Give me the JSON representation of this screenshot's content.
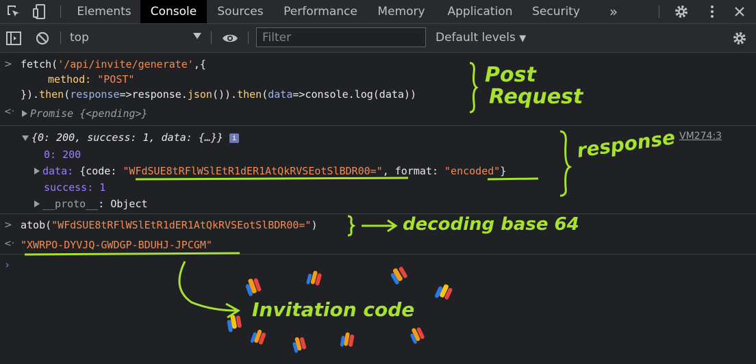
{
  "tabs": {
    "elements": "Elements",
    "console": "Console",
    "sources": "Sources",
    "performance": "Performance",
    "memory": "Memory",
    "application": "Application",
    "security": "Security",
    "more": "»"
  },
  "toolbar": {
    "context": "top",
    "filter_placeholder": "Filter",
    "levels": "Default levels"
  },
  "console": {
    "req_line1_a": "fetch(",
    "req_url": "'/api/invite/generate'",
    "req_line1_b": ",{",
    "req_method_key": "method: ",
    "req_method_val": "\"POST\"",
    "req_line3_a": "}).",
    "req_then1": "then",
    "req_line3_b": "(",
    "req_resp": "response",
    "req_line3_c": "=>response.",
    "req_json": "json",
    "req_line3_d": "()).",
    "req_then2": "then",
    "req_line3_e": "(",
    "req_data": "data",
    "req_line3_f": "=>console.log(data))",
    "promise": "Promise {<pending>}",
    "resp_summary": "{0: 200, success: 1, data: {…}}",
    "resp_link": "VM274:3",
    "resp_info": "i",
    "resp_zero_key": "0: ",
    "resp_zero_val": "200",
    "resp_data_key": "data: ",
    "resp_data_open": "{code: ",
    "resp_code": "\"WFdSUE8tRFlWSlEtR1dER1AtQkRVSEotSlBDR00=\"",
    "resp_format_key": ", format: ",
    "resp_format": "\"encoded\"",
    "resp_data_close": "}",
    "resp_success_key": "success: ",
    "resp_success_val": "1",
    "resp_proto_key": "__proto__",
    "resp_proto_val": ": Object",
    "atob_a": "atob(",
    "atob_arg": "\"WFdSUE8tRFlWSlEtR1dER1AtQkRVSEotSlBDR00=\"",
    "atob_b": ")",
    "result": "\"XWRPO-DYVJQ-GWDGP-BDUHJ-JPCGM\""
  },
  "annotations": {
    "post": "Post",
    "request": "Request",
    "response": "response",
    "decoding": "decoding base 64",
    "invitation": "Invitation code"
  },
  "colors": {
    "annotation": "#a6e22e",
    "string": "#f28b54",
    "background": "#202124"
  }
}
